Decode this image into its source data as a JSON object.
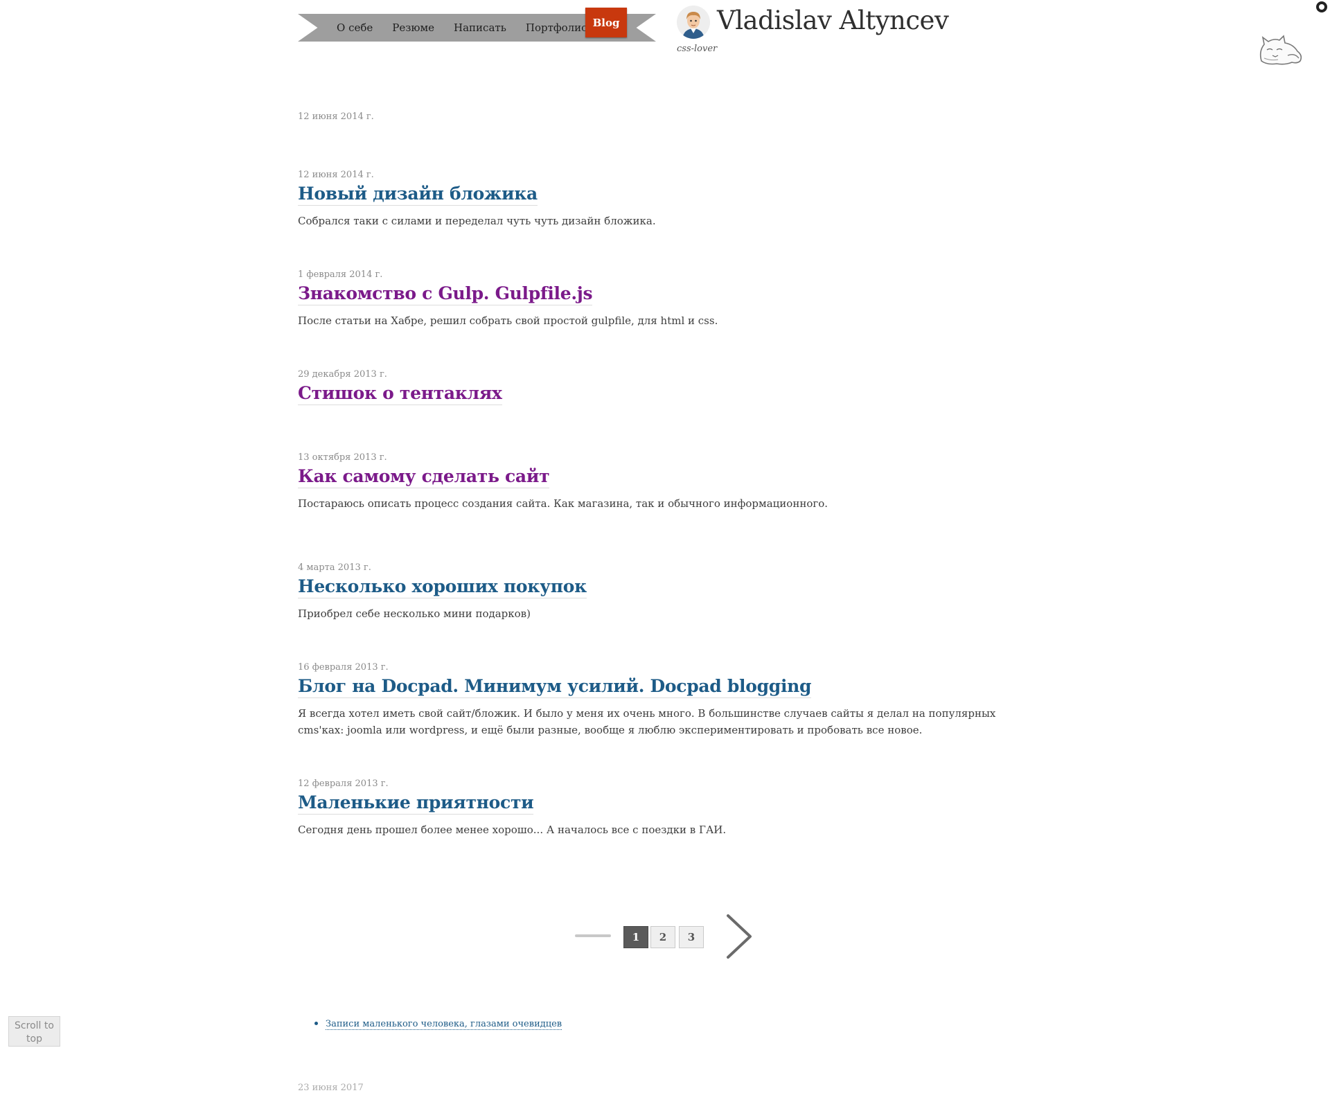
{
  "header": {
    "nav": [
      "О себе",
      "Резюме",
      "Написать",
      "Портфолио"
    ],
    "active_nav": "Blog",
    "site_title": "Vladislav Altyncev",
    "tagline": "css-lover",
    "icons": [
      "avatar",
      "github-icon",
      "cat-icon"
    ]
  },
  "top_date": "12 июня 2014 г.",
  "posts": [
    {
      "date": "12 июня 2014 г.",
      "title": "Новый дизайн бложика",
      "excerpt": "Собрался таки с силами и переделал чуть чуть дизайн бложика.",
      "visited": false
    },
    {
      "date": "1 февраля 2014 г.",
      "title": "Знакомство с Gulp. Gulpfile.js",
      "excerpt": "После статьи на Хабре, решил собрать свой простой gulpfile, для html и css.",
      "visited": true
    },
    {
      "date": "29 декабря 2013 г.",
      "title": "Стишок о тентаклях",
      "excerpt": "",
      "visited": true
    },
    {
      "date": "13 октября 2013 г.",
      "title": "Как самому сделать сайт",
      "excerpt": "Постараюсь описать процесс создания сайта. Как магазина, так и обычного информационного.",
      "visited": true
    },
    {
      "date": "4 марта 2013 г.",
      "title": "Несколько хороших покупок",
      "excerpt": "Приобрел себе несколько мини подарков)",
      "visited": false
    },
    {
      "date": "16 февраля 2013 г.",
      "title": "Блог на Docpad. Минимум усилий. Docpad blogging",
      "excerpt": "Я всегда хотел иметь свой сайт/бложик. И было у меня их очень много. В большинстве случаев сайты я делал на популярных cms'ках: joomla или wordpress, и ещё были разные, вообще я люблю экспериментировать и пробовать все новое.",
      "visited": false
    },
    {
      "date": "12 февраля 2013 г.",
      "title": "Маленькие приятности",
      "excerpt": "Сегодня день прошел более менее хорошо... А началось все с поездки в ГАИ.",
      "visited": false
    }
  ],
  "pagination": {
    "pages": [
      "1",
      "2",
      "3"
    ],
    "current": "1"
  },
  "footer": {
    "links": [
      "Записи маленького человека, глазами очевидцев"
    ],
    "scroll_top": "Scroll to top",
    "cut_text": "23 июня 2017"
  },
  "colors": {
    "ribbon": "#9e9e9e",
    "active": "#c8380e",
    "link": "#1d5b87",
    "visited": "#7b1a8a"
  }
}
